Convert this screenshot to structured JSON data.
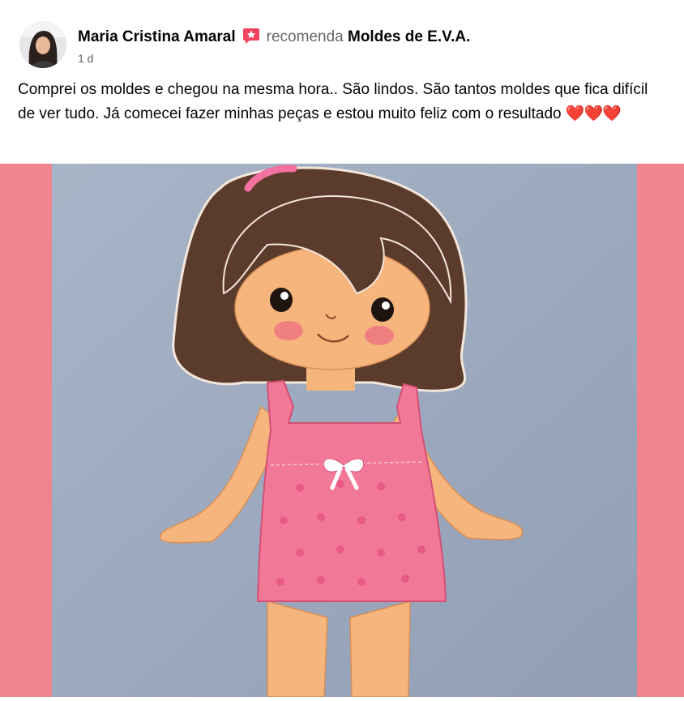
{
  "post": {
    "author": "Maria Cristina Amaral",
    "action": "recomenda",
    "page": "Moldes de E.V.A.",
    "timestamp": "1 d",
    "text": "Comprei os moldes e chegou na mesma hora.. São lindos. São tantos moldes que fica difícil de ver tudo. Já comecei fazer minhas peças e estou muito feliz com o resultado",
    "emoji": "❤️❤️❤️"
  },
  "icons": {
    "recommend": "recommend-star-icon",
    "avatar": "profile-avatar"
  },
  "colors": {
    "recommend_icon": "#f3425f",
    "side_panel": "#f1858e",
    "photo_background": "#9aa7bd",
    "dress": "#f27898",
    "hair": "#5b3b2b",
    "skin": "#f6b57c"
  }
}
